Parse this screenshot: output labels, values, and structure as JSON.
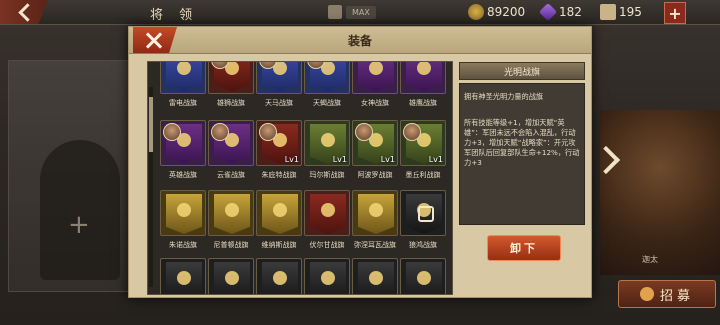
{
  "topbar": {
    "title": "将 领",
    "max_label": "MAX",
    "resources": [
      {
        "name": "gold-icon",
        "value": "89200"
      },
      {
        "name": "gem-icon",
        "value": "182"
      },
      {
        "name": "scroll-icon",
        "value": "195"
      }
    ],
    "plus_label": "+"
  },
  "background": {
    "right_general_name": "迦太",
    "plus_label": "+"
  },
  "recruit_button": {
    "label": "招募"
  },
  "modal": {
    "title": "装备",
    "rows": [
      {
        "cards": [
          {
            "name": "雷电战旗",
            "color": "blue",
            "avatar": false,
            "level": ""
          },
          {
            "name": "雄狮战旗",
            "color": "red",
            "avatar": true,
            "level": ""
          },
          {
            "name": "天马战旗",
            "color": "blue",
            "avatar": true,
            "level": ""
          },
          {
            "name": "天蝎战旗",
            "color": "blue",
            "avatar": true,
            "level": ""
          },
          {
            "name": "女神战旗",
            "color": "purple",
            "avatar": false,
            "level": ""
          },
          {
            "name": "雄鹰战旗",
            "color": "purple",
            "avatar": false,
            "level": ""
          }
        ]
      },
      {
        "cards": [
          {
            "name": "英雄战旗",
            "color": "purple",
            "avatar": true,
            "level": ""
          },
          {
            "name": "云雀战旗",
            "color": "purple",
            "avatar": true,
            "level": ""
          },
          {
            "name": "朱庇特战旗",
            "color": "red",
            "avatar": true,
            "level": "Lv1"
          },
          {
            "name": "玛尔斯战旗",
            "color": "green",
            "avatar": false,
            "level": "Lv1"
          },
          {
            "name": "阿波罗战旗",
            "color": "green",
            "avatar": true,
            "level": "Lv1"
          },
          {
            "name": "墨丘利战旗",
            "color": "green",
            "avatar": true,
            "level": "Lv1"
          }
        ]
      },
      {
        "cards": [
          {
            "name": "朱诺战旗",
            "color": "gold",
            "avatar": false,
            "level": ""
          },
          {
            "name": "尼普顿战旗",
            "color": "gold",
            "avatar": false,
            "level": ""
          },
          {
            "name": "维纳斯战旗",
            "color": "gold",
            "avatar": false,
            "level": ""
          },
          {
            "name": "伏尔甘战旗",
            "color": "red",
            "avatar": false,
            "level": ""
          },
          {
            "name": "弥涅耳瓦战旗",
            "color": "gold",
            "avatar": false,
            "level": ""
          },
          {
            "name": "狼鸿战旗",
            "color": "dark",
            "avatar": false,
            "level": "",
            "locked": true
          }
        ]
      },
      {
        "cards": [
          {
            "name": "",
            "color": "dark",
            "avatar": false,
            "level": ""
          },
          {
            "name": "",
            "color": "dark",
            "avatar": false,
            "level": ""
          },
          {
            "name": "",
            "color": "dark",
            "avatar": false,
            "level": ""
          },
          {
            "name": "",
            "color": "dark",
            "avatar": false,
            "level": ""
          },
          {
            "name": "",
            "color": "dark",
            "avatar": false,
            "level": ""
          },
          {
            "name": "",
            "color": "dark",
            "avatar": false,
            "level": ""
          }
        ]
      }
    ],
    "detail": {
      "title": "光明战旗",
      "description": "拥有神圣光明力量的战旗",
      "effect": "所有技能等级+1，增加天赋“英雄”：军团未远不会陷入混乱，行动力+3，增加天赋“战略家”：开元攻军团队后回复部队生命+12%，行动力+3"
    },
    "unequip_label": "卸下"
  },
  "colors": {
    "accent_red": "#962e14",
    "modal_bg": "#d8c9a4",
    "grid_bg": "#2c2823"
  }
}
